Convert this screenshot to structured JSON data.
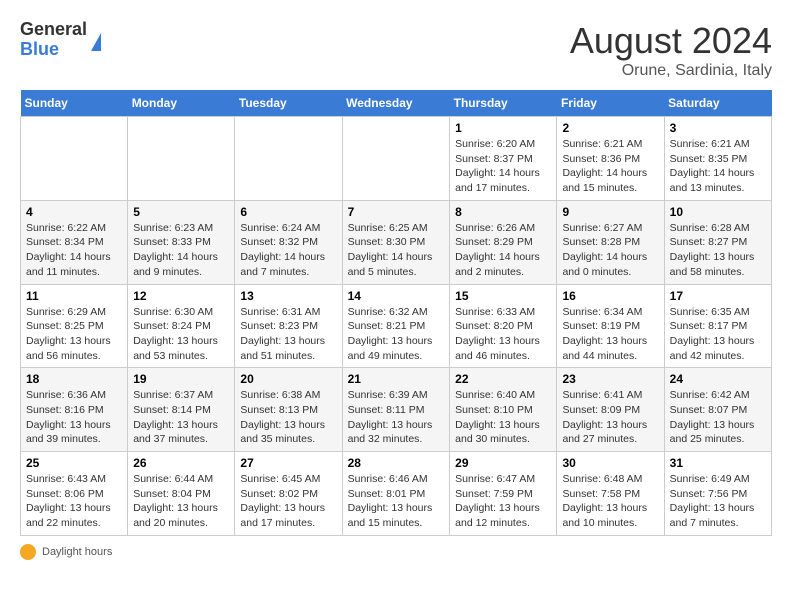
{
  "logo": {
    "general": "General",
    "blue": "Blue"
  },
  "title": {
    "month_year": "August 2024",
    "location": "Orune, Sardinia, Italy"
  },
  "days_of_week": [
    "Sunday",
    "Monday",
    "Tuesday",
    "Wednesday",
    "Thursday",
    "Friday",
    "Saturday"
  ],
  "weeks": [
    [
      {
        "day": "",
        "info": ""
      },
      {
        "day": "",
        "info": ""
      },
      {
        "day": "",
        "info": ""
      },
      {
        "day": "",
        "info": ""
      },
      {
        "day": "1",
        "info": "Sunrise: 6:20 AM\nSunset: 8:37 PM\nDaylight: 14 hours and 17 minutes."
      },
      {
        "day": "2",
        "info": "Sunrise: 6:21 AM\nSunset: 8:36 PM\nDaylight: 14 hours and 15 minutes."
      },
      {
        "day": "3",
        "info": "Sunrise: 6:21 AM\nSunset: 8:35 PM\nDaylight: 14 hours and 13 minutes."
      }
    ],
    [
      {
        "day": "4",
        "info": "Sunrise: 6:22 AM\nSunset: 8:34 PM\nDaylight: 14 hours and 11 minutes."
      },
      {
        "day": "5",
        "info": "Sunrise: 6:23 AM\nSunset: 8:33 PM\nDaylight: 14 hours and 9 minutes."
      },
      {
        "day": "6",
        "info": "Sunrise: 6:24 AM\nSunset: 8:32 PM\nDaylight: 14 hours and 7 minutes."
      },
      {
        "day": "7",
        "info": "Sunrise: 6:25 AM\nSunset: 8:30 PM\nDaylight: 14 hours and 5 minutes."
      },
      {
        "day": "8",
        "info": "Sunrise: 6:26 AM\nSunset: 8:29 PM\nDaylight: 14 hours and 2 minutes."
      },
      {
        "day": "9",
        "info": "Sunrise: 6:27 AM\nSunset: 8:28 PM\nDaylight: 14 hours and 0 minutes."
      },
      {
        "day": "10",
        "info": "Sunrise: 6:28 AM\nSunset: 8:27 PM\nDaylight: 13 hours and 58 minutes."
      }
    ],
    [
      {
        "day": "11",
        "info": "Sunrise: 6:29 AM\nSunset: 8:25 PM\nDaylight: 13 hours and 56 minutes."
      },
      {
        "day": "12",
        "info": "Sunrise: 6:30 AM\nSunset: 8:24 PM\nDaylight: 13 hours and 53 minutes."
      },
      {
        "day": "13",
        "info": "Sunrise: 6:31 AM\nSunset: 8:23 PM\nDaylight: 13 hours and 51 minutes."
      },
      {
        "day": "14",
        "info": "Sunrise: 6:32 AM\nSunset: 8:21 PM\nDaylight: 13 hours and 49 minutes."
      },
      {
        "day": "15",
        "info": "Sunrise: 6:33 AM\nSunset: 8:20 PM\nDaylight: 13 hours and 46 minutes."
      },
      {
        "day": "16",
        "info": "Sunrise: 6:34 AM\nSunset: 8:19 PM\nDaylight: 13 hours and 44 minutes."
      },
      {
        "day": "17",
        "info": "Sunrise: 6:35 AM\nSunset: 8:17 PM\nDaylight: 13 hours and 42 minutes."
      }
    ],
    [
      {
        "day": "18",
        "info": "Sunrise: 6:36 AM\nSunset: 8:16 PM\nDaylight: 13 hours and 39 minutes."
      },
      {
        "day": "19",
        "info": "Sunrise: 6:37 AM\nSunset: 8:14 PM\nDaylight: 13 hours and 37 minutes."
      },
      {
        "day": "20",
        "info": "Sunrise: 6:38 AM\nSunset: 8:13 PM\nDaylight: 13 hours and 35 minutes."
      },
      {
        "day": "21",
        "info": "Sunrise: 6:39 AM\nSunset: 8:11 PM\nDaylight: 13 hours and 32 minutes."
      },
      {
        "day": "22",
        "info": "Sunrise: 6:40 AM\nSunset: 8:10 PM\nDaylight: 13 hours and 30 minutes."
      },
      {
        "day": "23",
        "info": "Sunrise: 6:41 AM\nSunset: 8:09 PM\nDaylight: 13 hours and 27 minutes."
      },
      {
        "day": "24",
        "info": "Sunrise: 6:42 AM\nSunset: 8:07 PM\nDaylight: 13 hours and 25 minutes."
      }
    ],
    [
      {
        "day": "25",
        "info": "Sunrise: 6:43 AM\nSunset: 8:06 PM\nDaylight: 13 hours and 22 minutes."
      },
      {
        "day": "26",
        "info": "Sunrise: 6:44 AM\nSunset: 8:04 PM\nDaylight: 13 hours and 20 minutes."
      },
      {
        "day": "27",
        "info": "Sunrise: 6:45 AM\nSunset: 8:02 PM\nDaylight: 13 hours and 17 minutes."
      },
      {
        "day": "28",
        "info": "Sunrise: 6:46 AM\nSunset: 8:01 PM\nDaylight: 13 hours and 15 minutes."
      },
      {
        "day": "29",
        "info": "Sunrise: 6:47 AM\nSunset: 7:59 PM\nDaylight: 13 hours and 12 minutes."
      },
      {
        "day": "30",
        "info": "Sunrise: 6:48 AM\nSunset: 7:58 PM\nDaylight: 13 hours and 10 minutes."
      },
      {
        "day": "31",
        "info": "Sunrise: 6:49 AM\nSunset: 7:56 PM\nDaylight: 13 hours and 7 minutes."
      }
    ]
  ],
  "footer": {
    "label": "Daylight hours"
  }
}
